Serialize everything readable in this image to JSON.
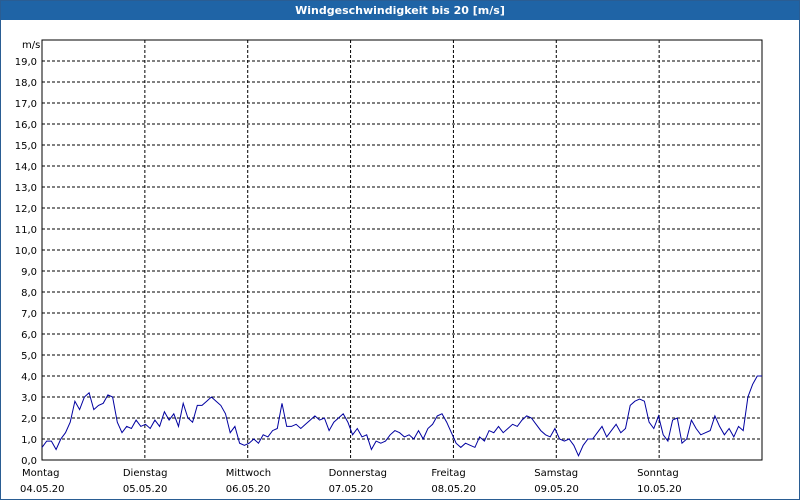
{
  "window": {
    "title": "Windgeschwindigkeit bis 20 [m/s]"
  },
  "colors": {
    "titlebar": "#1f64a6",
    "line": "#0000a0",
    "grid": "#000000"
  },
  "chart_data": {
    "type": "line",
    "title": "Windgeschwindigkeit bis 20 [m/s]",
    "ylabel": "m/s",
    "ylim": [
      0,
      20
    ],
    "yticks": [
      "0,0",
      "1,0",
      "2,0",
      "3,0",
      "4,0",
      "5,0",
      "6,0",
      "7,0",
      "8,0",
      "9,0",
      "10,0",
      "11,0",
      "12,0",
      "13,0",
      "14,0",
      "15,0",
      "16,0",
      "17,0",
      "18,0",
      "19,0"
    ],
    "xlim_days": [
      0,
      7
    ],
    "days": [
      {
        "weekday": "Montag",
        "date": "04.05.20"
      },
      {
        "weekday": "Dienstag",
        "date": "05.05.20"
      },
      {
        "weekday": "Mittwoch",
        "date": "06.05.20"
      },
      {
        "weekday": "Donnerstag",
        "date": "07.05.20"
      },
      {
        "weekday": "Freitag",
        "date": "08.05.20"
      },
      {
        "weekday": "Samstag",
        "date": "09.05.20"
      },
      {
        "weekday": "Sonntag",
        "date": "10.05.20"
      }
    ],
    "grid": true,
    "series": [
      {
        "values": [
          0.6,
          0.9,
          0.9,
          0.5,
          1.0,
          1.3,
          1.8,
          2.8,
          2.4,
          3.0,
          3.2,
          2.4,
          2.6,
          2.7,
          3.1,
          3.0,
          1.8,
          1.3,
          1.6,
          1.5,
          1.9,
          1.6,
          1.7,
          1.5,
          1.9,
          1.6,
          2.3,
          1.9,
          2.2,
          1.6,
          2.7,
          2.0,
          1.8,
          2.6,
          2.6,
          2.8,
          3.0,
          2.8,
          2.6,
          2.2,
          1.3,
          1.6,
          0.8,
          0.7,
          0.8,
          1.0,
          0.8,
          1.2,
          1.1,
          1.4,
          1.5,
          2.7,
          1.6,
          1.6,
          1.7,
          1.5,
          1.7,
          1.9,
          2.1,
          1.9,
          2.0,
          1.4,
          1.8,
          2.0,
          2.2,
          1.8,
          1.2,
          1.5,
          1.1,
          1.2,
          0.5,
          0.9,
          0.8,
          0.9,
          1.2,
          1.4,
          1.3,
          1.1,
          1.2,
          1.0,
          1.4,
          1.0,
          1.5,
          1.7,
          2.1,
          2.2,
          1.8,
          1.3,
          0.8,
          0.6,
          0.8,
          0.7,
          0.6,
          1.1,
          0.9,
          1.4,
          1.3,
          1.6,
          1.3,
          1.5,
          1.7,
          1.6,
          1.9,
          2.1,
          2.0,
          1.7,
          1.4,
          1.2,
          1.1,
          1.5,
          1.0,
          0.9,
          1.0,
          0.7,
          0.2,
          0.7,
          1.0,
          1.0,
          1.3,
          1.6,
          1.1,
          1.4,
          1.7,
          1.3,
          1.5,
          2.6,
          2.8,
          2.9,
          2.8,
          1.8,
          1.5,
          2.1,
          1.2,
          0.9,
          1.9,
          2.0,
          0.8,
          1.0,
          1.9,
          1.5,
          1.2,
          1.3,
          1.4,
          2.1,
          1.6,
          1.2,
          1.5,
          1.1,
          1.6,
          1.4,
          3.0,
          3.6,
          4.0,
          4.0
        ]
      }
    ]
  }
}
